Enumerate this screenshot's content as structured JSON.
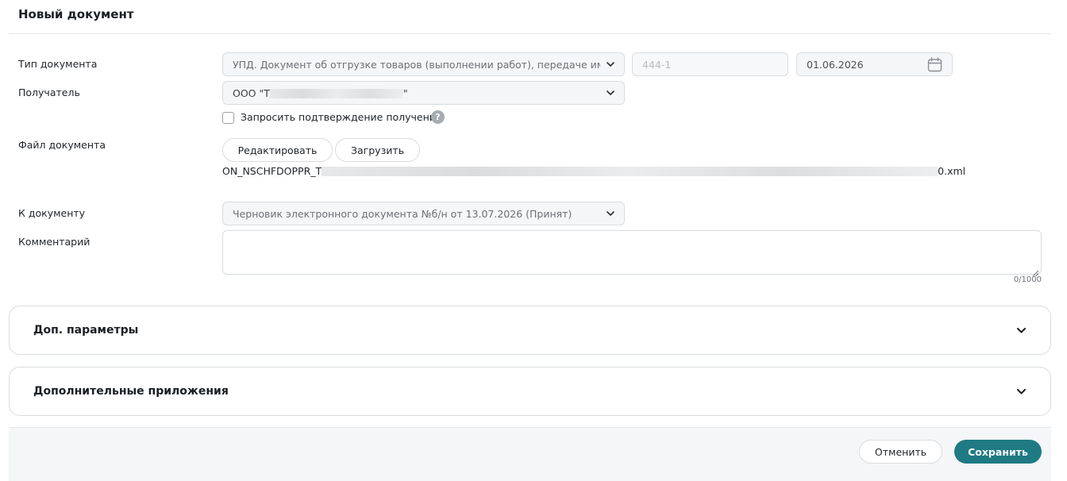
{
  "page": {
    "title": "Новый документ"
  },
  "form": {
    "doc_type": {
      "label": "Тип документа",
      "value": "УПД. Документ об отгрузке товаров (выполнении работ), передаче имущественных прав",
      "number_placeholder": "444-1",
      "date_value": "01.06.2026"
    },
    "recipient": {
      "label": "Получатель",
      "value_prefix": "ООО \"Т",
      "value_suffix": "\""
    },
    "confirm_receipt": {
      "label": "Запросить подтверждение получения",
      "checked": false,
      "help_glyph": "?"
    },
    "file": {
      "label": "Файл документа",
      "edit_label": "Редактировать",
      "upload_label": "Загрузить",
      "filename_prefix": "ON_NSCHFDOPPR_T",
      "filename_suffix": "0.xml"
    },
    "to_document": {
      "label": "К документу",
      "value": "Черновик электронного документа №б/н от 13.07.2026 (Принят)"
    },
    "comment": {
      "label": "Комментарий",
      "value": "",
      "counter": "0/1000"
    }
  },
  "sections": [
    {
      "title": "Доп. параметры",
      "expanded": false
    },
    {
      "title": "Дополнительные приложения",
      "expanded": false
    }
  ],
  "footer": {
    "cancel_label": "Отменить",
    "save_label": "Сохранить"
  },
  "colors": {
    "accent": "#1f7a83",
    "border": "#d9dcdf",
    "field_bg": "#f5f6f7"
  },
  "icons": {
    "dropdown": "chevron-down-icon",
    "date": "calendar-icon",
    "help": "help-icon"
  }
}
